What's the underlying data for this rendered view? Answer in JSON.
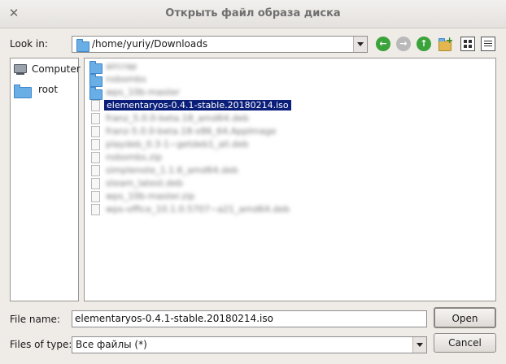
{
  "window": {
    "title": "Открыть файл образа диска",
    "close_symbol": "✕"
  },
  "lookin": {
    "label": "Look in:",
    "path": "/home/yuriy/Downloads",
    "nav_icons": [
      "back-icon",
      "forward-icon",
      "up-icon",
      "new-folder-icon",
      "icon-view-icon",
      "list-view-icon"
    ]
  },
  "sidebar": {
    "items": [
      {
        "label": "Computer",
        "icon": "computer-icon"
      },
      {
        "label": "root",
        "icon": "folder-icon"
      }
    ]
  },
  "files": {
    "selected_name": "elementaryos-0.4.1-stable.20180214.iso",
    "entries": [
      {
        "kind": "folder",
        "name": "aircrap"
      },
      {
        "kind": "folder",
        "name": "nsbombs"
      },
      {
        "kind": "folder",
        "name": "wps_10b-master"
      },
      {
        "kind": "file",
        "name": "elementaryos-0.4.1-stable.20180214.iso",
        "selected": true
      },
      {
        "kind": "file",
        "name": "franz_5.0.0-beta.18_amd64.deb"
      },
      {
        "kind": "file",
        "name": "franz-5.0.0-beta.18-x86_64.AppImage"
      },
      {
        "kind": "file",
        "name": "playdeb_0.3-1~getdeb1_all.deb"
      },
      {
        "kind": "file",
        "name": "nsbombs.zip"
      },
      {
        "kind": "file",
        "name": "simplenote_1.1.6_amd64.deb"
      },
      {
        "kind": "file",
        "name": "steam_latest.deb"
      },
      {
        "kind": "file",
        "name": "wps_10b-master.zip"
      },
      {
        "kind": "file",
        "name": "wps-office_10.1.0.5707~a21_amd64.deb"
      }
    ]
  },
  "filename": {
    "label": "File name:",
    "value": "elementaryos-0.4.1-stable.20180214.iso"
  },
  "filetype": {
    "label": "Files of type:",
    "value": "Все файлы (*)"
  },
  "buttons": {
    "open": "Open",
    "cancel": "Cancel"
  },
  "colors": {
    "selection": "#0b1f7a",
    "folder": "#6aaee6",
    "nav_green": "#3aa33a"
  }
}
